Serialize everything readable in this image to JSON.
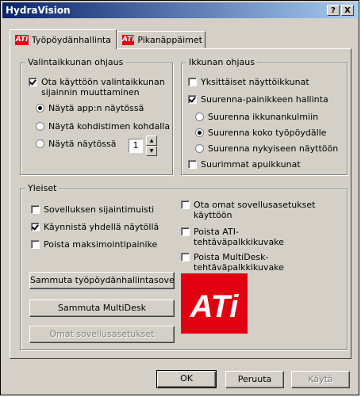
{
  "window": {
    "title": "HydraVision",
    "help_btn": "?",
    "close_btn": "X"
  },
  "tabs": [
    {
      "label": "Työpöydänhallinta",
      "icon": "ati-logo-icon",
      "active": true
    },
    {
      "label": "Pikanäppäimet",
      "icon": "ati-logo-icon",
      "active": false
    }
  ],
  "groups": {
    "selection": {
      "title": "Valintaikkunan ohjaus",
      "enable_label": "Ota käyttöön valintaikkunan sijainnin muuttaminen",
      "enable_checked": true,
      "radios": [
        {
          "label": "Näytä app:n näytössä",
          "checked": true
        },
        {
          "label": "Näytä kohdistimen kohdalla",
          "checked": false
        },
        {
          "label": "Näytä näytössä",
          "checked": false
        }
      ],
      "monitor_value": "1"
    },
    "window_control": {
      "title": "Ikkunan ohjaus",
      "individual_label": "Yksittäiset näyttöikkunat",
      "individual_checked": false,
      "maximize_label": "Suurenna-painikkeen hallinta",
      "maximize_checked": true,
      "radios": [
        {
          "label": "Suurenna ikkunankulmiin",
          "checked": false
        },
        {
          "label": "Suurenna koko työpöydälle",
          "checked": true
        },
        {
          "label": "Suurenna nykyiseen näyttöön",
          "checked": false
        }
      ],
      "larger_label": "Suurimmat apuikkunat",
      "larger_checked": false
    },
    "general": {
      "title": "Yleiset",
      "left_checks": [
        {
          "label": "Sovelluksen sijaintimuisti",
          "checked": false
        },
        {
          "label": "Käynnistä yhdellä näytöllä",
          "checked": true
        },
        {
          "label": "Poista maksimointipainike",
          "checked": false
        }
      ],
      "right_checks": [
        {
          "label": "Ota omat sovellusasetukset käyttöön",
          "checked": false
        },
        {
          "label": "Poista ATI-tehtäväpalkkikuvake",
          "checked": false
        },
        {
          "label": "Poista MultiDesk-tehtäväpalkkikuvake",
          "checked": false
        }
      ],
      "buttons": {
        "shutdown_desktop": "Sammuta työpöydänhallintasovellus",
        "shutdown_multidesk": "Sammuta MultiDesk",
        "app_settings": "Omat sovellusasetukset"
      },
      "logo_text": "ATi"
    }
  },
  "footer": {
    "ok": "OK",
    "cancel": "Peruuta",
    "apply": "Käytä"
  },
  "colors": {
    "titlebar_start": "#0a246a",
    "titlebar_end": "#a6caf0",
    "face": "#d4d0c8",
    "ati_red": "#e00010"
  }
}
